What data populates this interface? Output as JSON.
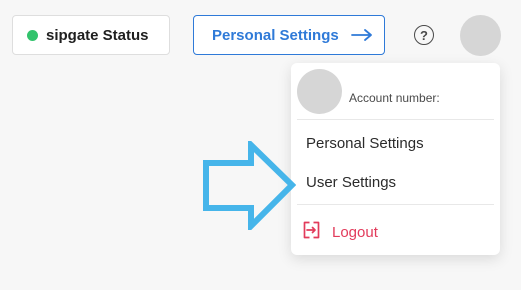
{
  "header": {
    "status_label": "sipgate Status",
    "personal_settings_label": "Personal Settings",
    "help_icon": "help-circle-icon"
  },
  "dropdown": {
    "account_label": "Account number:",
    "menu": {
      "personal_settings": "Personal Settings",
      "user_settings": "User Settings",
      "logout": "Logout"
    }
  },
  "colors": {
    "status_green": "#32c36c",
    "accent_blue": "#2f7ad8",
    "logout_red": "#e23b5b",
    "annotation_blue": "#46b5ea"
  }
}
